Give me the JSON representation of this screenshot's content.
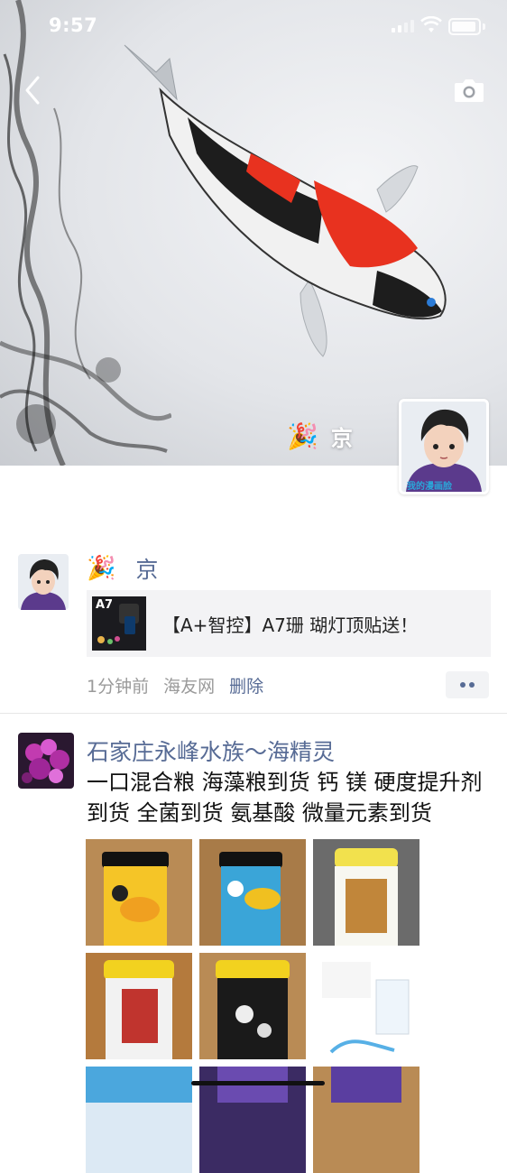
{
  "status_bar": {
    "time": "9:57"
  },
  "cover": {
    "name": "京",
    "name_emoji": "🎉",
    "avatar_caption": "我的漫画脸"
  },
  "posts": [
    {
      "name": "京",
      "name_emoji": "🎉",
      "link": {
        "thumb_label": "A7",
        "title": "【A+智控】A7珊 瑚灯顶贴送！"
      },
      "time": "1分钟前",
      "source": "海友网",
      "delete_label": "删除"
    },
    {
      "name": "石家庄永峰水族～海精灵",
      "text": "一口混合粮 海藻粮到货 钙 镁 硬度提升剂到货 全菌到货 氨基酸 微量元素到货",
      "images": [
        "product-photo-1",
        "product-photo-2",
        "product-photo-3",
        "product-photo-4",
        "product-photo-5",
        "product-photo-6",
        "product-photo-7",
        "product-photo-8",
        "product-photo-9"
      ]
    }
  ],
  "icons": {
    "back": "chevron-left-icon",
    "camera": "camera-icon",
    "more": "more-dots-icon"
  },
  "colors": {
    "link_blue": "#576b95",
    "meta_gray": "#9a9a9a",
    "card_bg": "#f3f3f5"
  }
}
